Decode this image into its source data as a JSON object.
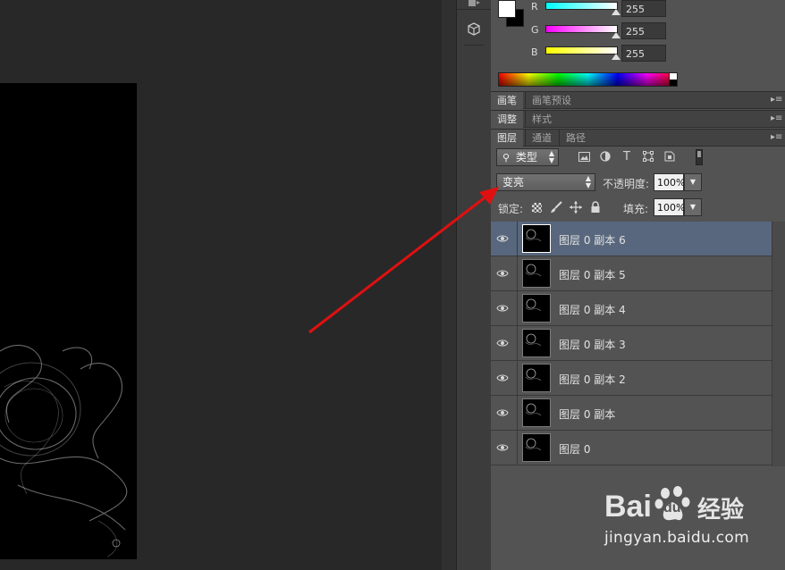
{
  "color_panel": {
    "channels": [
      {
        "label": "R",
        "value": "255",
        "gradient": [
          "#00ffff",
          "#ffffff"
        ]
      },
      {
        "label": "G",
        "value": "255",
        "gradient": [
          "#ff00ff",
          "#ffffff"
        ]
      },
      {
        "label": "B",
        "value": "255",
        "gradient": [
          "#ffff00",
          "#ffffff"
        ]
      }
    ],
    "foreground_color": "#ffffff",
    "background_color": "#000000"
  },
  "panel_groups": [
    {
      "tabs": [
        "画笔",
        "画笔预设"
      ],
      "active": 0
    },
    {
      "tabs": [
        "调整",
        "样式"
      ],
      "active": 0
    },
    {
      "tabs": [
        "图层",
        "通道",
        "路径"
      ],
      "active": 0
    }
  ],
  "layers_panel": {
    "filter_kind": "类型",
    "filter_icons": [
      "image-filter-icon",
      "adjustment-filter-icon",
      "type-filter-icon",
      "shape-filter-icon",
      "smart-object-filter-icon"
    ],
    "blend_mode": "变亮",
    "opacity_label": "不透明度:",
    "opacity_value": "100%",
    "lock_label": "锁定:",
    "fill_label": "填充:",
    "fill_value": "100%",
    "layers": [
      {
        "name": "图层 0 副本 6",
        "selected": true
      },
      {
        "name": "图层 0 副本 5",
        "selected": false
      },
      {
        "name": "图层 0 副本 4",
        "selected": false
      },
      {
        "name": "图层 0 副本 3",
        "selected": false
      },
      {
        "name": "图层 0 副本 2",
        "selected": false
      },
      {
        "name": "图层 0 副本",
        "selected": false
      },
      {
        "name": "图层 0",
        "selected": false
      }
    ]
  },
  "watermark": {
    "logo_text": "Bai",
    "logo_text2": "du",
    "logo_suffix": "经验",
    "url": "jingyan.baidu.com"
  },
  "annotation": {
    "arrow_color": "#e01010"
  }
}
